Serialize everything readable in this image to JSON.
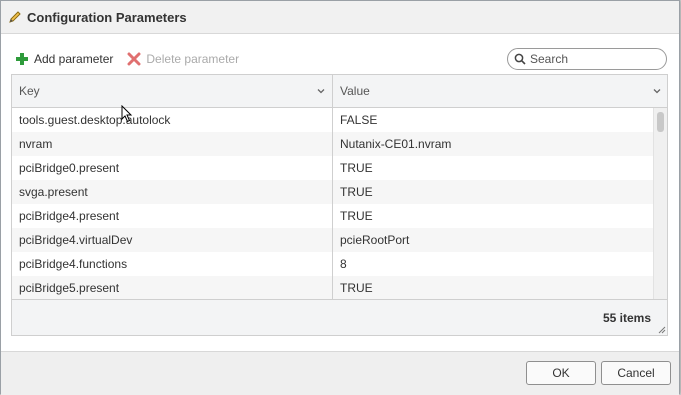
{
  "window": {
    "title": "Configuration Parameters",
    "icon": "pencil-icon"
  },
  "toolbar": {
    "add_label": "Add parameter",
    "add_icon": "plus-icon",
    "delete_label": "Delete parameter",
    "delete_icon": "delete-x-icon"
  },
  "search": {
    "placeholder": "Search",
    "value": ""
  },
  "grid": {
    "columns": [
      "Key",
      "Value"
    ],
    "rows": [
      {
        "key": "tools.guest.desktop.autolock",
        "value": "FALSE"
      },
      {
        "key": "nvram",
        "value": "Nutanix-CE01.nvram"
      },
      {
        "key": "pciBridge0.present",
        "value": "TRUE"
      },
      {
        "key": "svga.present",
        "value": "TRUE"
      },
      {
        "key": "pciBridge4.present",
        "value": "TRUE"
      },
      {
        "key": "pciBridge4.virtualDev",
        "value": "pcieRootPort"
      },
      {
        "key": "pciBridge4.functions",
        "value": "8"
      },
      {
        "key": "pciBridge5.present",
        "value": "TRUE"
      }
    ],
    "item_count": "55 items"
  },
  "footer": {
    "ok_label": "OK",
    "cancel_label": "Cancel"
  },
  "colors": {
    "add_icon": "#2e9b3b",
    "delete_icon": "#e07070",
    "pencil_icon": "#d9a21b"
  }
}
